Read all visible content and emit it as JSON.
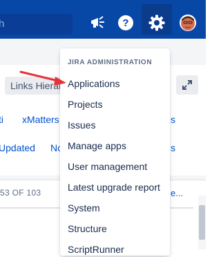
{
  "topbar": {
    "search_text": "h",
    "icons": [
      "megaphone-icon",
      "help-icon",
      "gear-icon",
      "avatar"
    ]
  },
  "background": {
    "links_button_label": "Links Hierarc",
    "link_row_1": [
      "ti",
      "xMatters",
      "s"
    ],
    "link_row_2": [
      "Updated",
      "No",
      "s"
    ],
    "count_text": "53 OF 103",
    "row_link_tail": "e..."
  },
  "dropdown": {
    "heading": "JIRA ADMINISTRATION",
    "items": [
      "Applications",
      "Projects",
      "Issues",
      "Manage apps",
      "User management",
      "Latest upgrade report",
      "System",
      "Structure",
      "ScriptRunner"
    ]
  },
  "colors": {
    "topbar": "#0747A6",
    "link": "#0052CC",
    "annotation_arrow": "#E5333B"
  }
}
